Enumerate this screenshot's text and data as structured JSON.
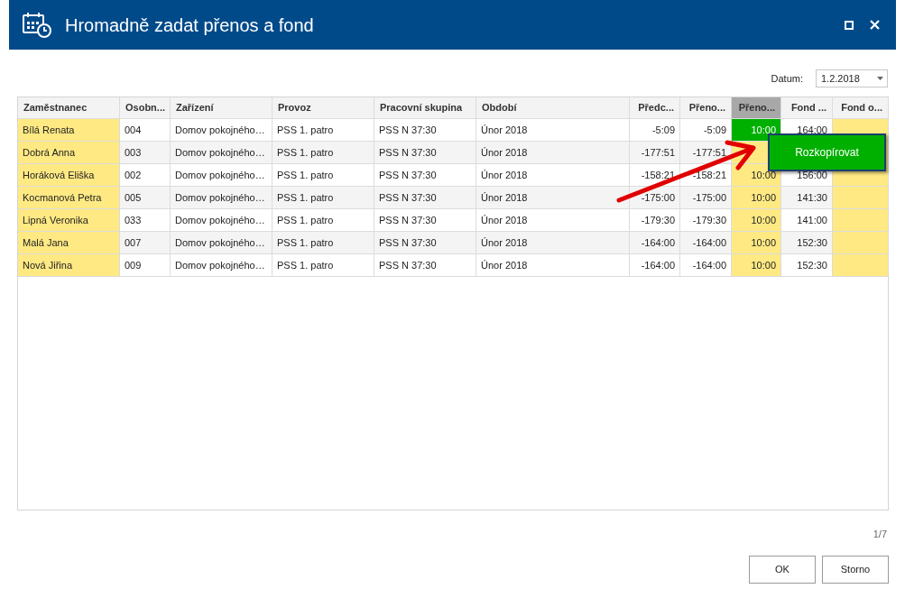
{
  "window": {
    "title": "Hromadně zadat přenos a fond"
  },
  "date": {
    "label": "Datum:",
    "value": "1.2.2018"
  },
  "table": {
    "columns": [
      {
        "label": "Zaměstnanec",
        "kind": "text",
        "editable": true,
        "selected": false
      },
      {
        "label": "Osobn...",
        "kind": "text",
        "editable": false,
        "selected": false
      },
      {
        "label": "Zařízení",
        "kind": "text",
        "editable": false,
        "selected": false
      },
      {
        "label": "Provoz",
        "kind": "text",
        "editable": false,
        "selected": false
      },
      {
        "label": "Pracovní skupina",
        "kind": "text",
        "editable": false,
        "selected": false
      },
      {
        "label": "Období",
        "kind": "text",
        "editable": false,
        "selected": false
      },
      {
        "label": "Předc...",
        "kind": "time",
        "editable": false,
        "selected": false
      },
      {
        "label": "Přeno...",
        "kind": "time",
        "editable": false,
        "selected": false
      },
      {
        "label": "Přeno...",
        "kind": "time",
        "editable": true,
        "selected": true
      },
      {
        "label": "Fond ...",
        "kind": "time",
        "editable": false,
        "selected": false
      },
      {
        "label": "Fond o...",
        "kind": "time",
        "editable": true,
        "selected": false
      }
    ],
    "rows": [
      {
        "focused": true,
        "cells": [
          "Bílá Renata",
          "004",
          "Domov pokojného…",
          "PSS 1. patro",
          "PSS N 37:30",
          "Únor 2018",
          "-5:09",
          "-5:09",
          "10:00",
          "164:00",
          null
        ]
      },
      {
        "focused": false,
        "cells": [
          "Dobrá Anna",
          "003",
          "Domov pokojného…",
          "PSS 1. patro",
          "PSS N 37:30",
          "Únor 2018",
          "-177:51",
          "-177:51",
          null,
          null,
          null
        ]
      },
      {
        "focused": false,
        "cells": [
          "Horáková Eliška",
          "002",
          "Domov pokojného…",
          "PSS 1. patro",
          "PSS N 37:30",
          "Únor 2018",
          "-158:21",
          "-158:21",
          "10:00",
          "156:00",
          null
        ]
      },
      {
        "focused": false,
        "cells": [
          "Kocmanová Petra",
          "005",
          "Domov pokojného…",
          "PSS 1. patro",
          "PSS N 37:30",
          "Únor 2018",
          "-175:00",
          "-175:00",
          "10:00",
          "141:30",
          null
        ]
      },
      {
        "focused": false,
        "cells": [
          "Lipná Veronika",
          "033",
          "Domov pokojného…",
          "PSS 1. patro",
          "PSS N 37:30",
          "Únor 2018",
          "-179:30",
          "-179:30",
          "10:00",
          "141:00",
          null
        ]
      },
      {
        "focused": false,
        "cells": [
          "Malá Jana",
          "007",
          "Domov pokojného…",
          "PSS 1. patro",
          "PSS N 37:30",
          "Únor 2018",
          "-164:00",
          "-164:00",
          "10:00",
          "152:30",
          null
        ]
      },
      {
        "focused": false,
        "cells": [
          "Nová Jiřina",
          "009",
          "Domov pokojného…",
          "PSS 1. patro",
          "PSS N 37:30",
          "Únor 2018",
          "-164:00",
          "-164:00",
          "10:00",
          "152:30",
          null
        ]
      }
    ]
  },
  "popup": {
    "label": "Rozkopírovat"
  },
  "pager": "1/7",
  "buttons": [
    "OK",
    "Storno"
  ]
}
